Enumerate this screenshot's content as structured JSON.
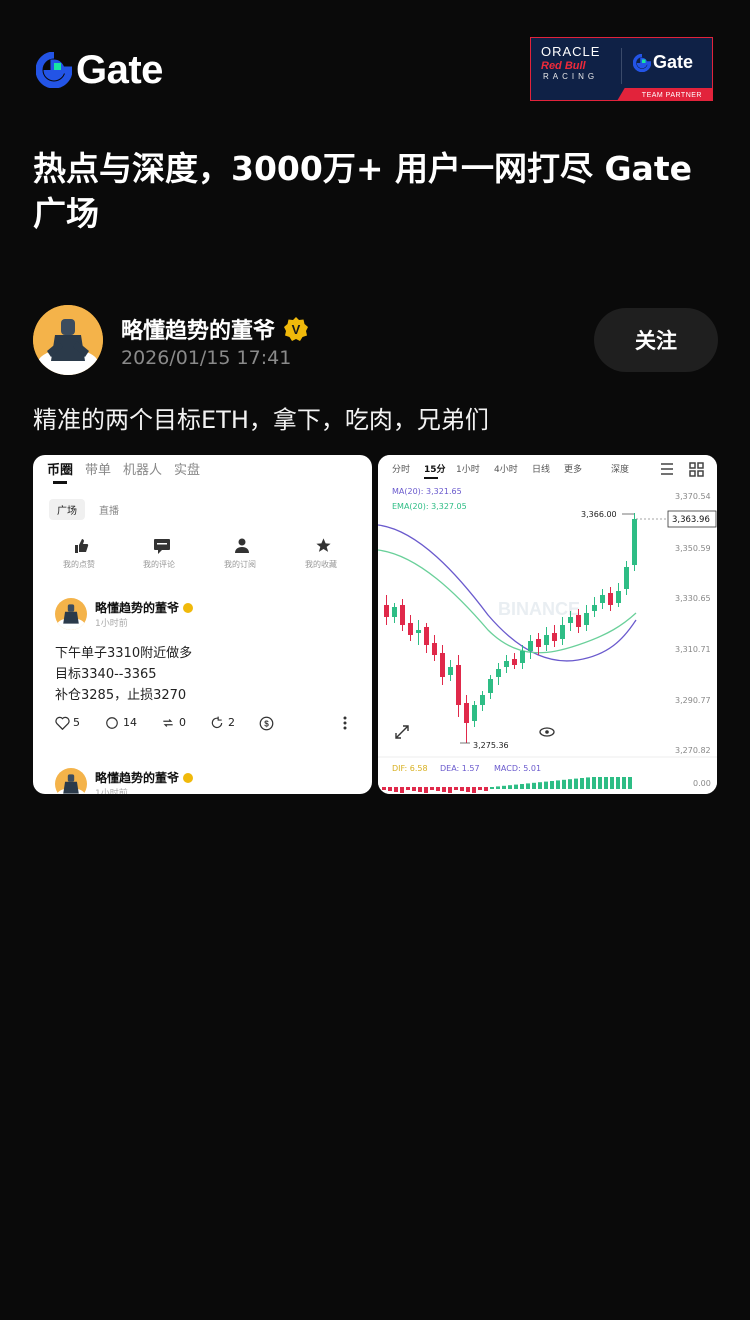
{
  "brand": {
    "logo_text": "Gate"
  },
  "partner_banner": {
    "oracle": "ORACLE",
    "redbull": "Red Bull",
    "racing": "RACING",
    "gate": "Gate",
    "team_partner": "TEAM PARTNER"
  },
  "headline": "热点与深度，3000万+ 用户一网打尽 Gate 广场",
  "post": {
    "author_name": "略懂趋势的董爷",
    "verified_badge": "V",
    "timestamp": "2026/01/15 17:41",
    "follow_label": "关注",
    "text": "精准的两个目标ETH，拿下，吃肉，兄弟们"
  },
  "screenshot_left": {
    "tabs": [
      "币圈",
      "带单",
      "机器人",
      "实盘"
    ],
    "subtabs": [
      "广场",
      "直播"
    ],
    "actions": [
      "我的点赞",
      "我的评论",
      "我的订阅",
      "我的收藏"
    ],
    "post_author": "略懂趋势的董爷",
    "post_time": "1小时前",
    "lines": [
      "下午单子3310附近做多",
      "目标3340--3365",
      "补仓3285，止损3270"
    ],
    "likes": "5",
    "comments": "14",
    "reposts": "0",
    "shares": "2",
    "second_author": "略懂趋势的董爷",
    "second_time": "1小时前"
  },
  "screenshot_right": {
    "intervals": [
      "分时",
      "15分",
      "1小时",
      "4小时",
      "日线",
      "更多",
      "深度"
    ],
    "ma20": "MA(20): 3,321.65",
    "ema20": "EMA(20): 3,327.05",
    "high_label": "3,366.00",
    "current_price": "3,363.96",
    "low_label": "3,275.36",
    "watermark": "BINANCE",
    "y_ticks": [
      "3,370.54",
      "3,350.59",
      "3,330.65",
      "3,310.71",
      "3,290.77",
      "3,270.82"
    ],
    "macd_zero": "0.00",
    "dif": "DIF: 6.58",
    "dea": "DEA: 1.57",
    "macd": "MACD: 5.01"
  },
  "colors": {
    "background": "#0a0a0a",
    "gate_blue": "#2354e6",
    "gate_green": "#17e6a1",
    "up": "#2ebd85",
    "down": "#e0294a",
    "badge": "#f0b90b"
  }
}
